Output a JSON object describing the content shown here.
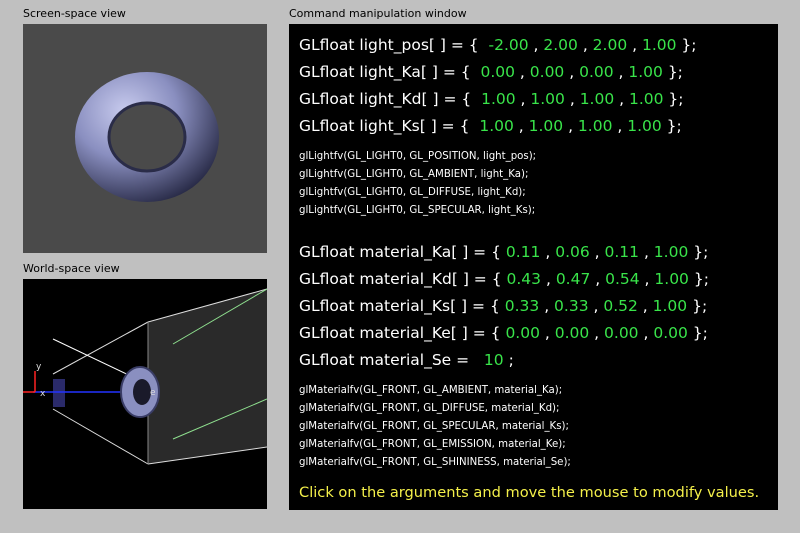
{
  "labels": {
    "screen_view": "Screen-space view",
    "world_view": "World-space view",
    "command_window": "Command manipulation window"
  },
  "colors": {
    "background": "#c0c0c0",
    "value": "#39e44a",
    "hint": "#f4f04a",
    "torus": "#8a8fc0"
  },
  "world_view": {
    "axis_x": "x",
    "axis_y": "y",
    "eye": "e"
  },
  "light": {
    "pos": {
      "decl": "GLfloat light_pos[ ] = {",
      "v": [
        "-2.00",
        "2.00",
        "2.00",
        "1.00"
      ]
    },
    "ka": {
      "decl": "GLfloat light_Ka[ ] = {",
      "v": [
        "0.00",
        "0.00",
        "0.00",
        "1.00"
      ]
    },
    "kd": {
      "decl": "GLfloat light_Kd[ ] = {",
      "v": [
        "1.00",
        "1.00",
        "1.00",
        "1.00"
      ]
    },
    "ks": {
      "decl": "GLfloat light_Ks[ ] = {",
      "v": [
        "1.00",
        "1.00",
        "1.00",
        "1.00"
      ]
    }
  },
  "light_calls": [
    "glLightfv(GL_LIGHT0, GL_POSITION, light_pos);",
    "glLightfv(GL_LIGHT0, GL_AMBIENT, light_Ka);",
    "glLightfv(GL_LIGHT0, GL_DIFFUSE, light_Kd);",
    "glLightfv(GL_LIGHT0, GL_SPECULAR, light_Ks);"
  ],
  "material": {
    "ka": {
      "decl": "GLfloat material_Ka[ ] = {",
      "v": [
        "0.11",
        "0.06",
        "0.11",
        "1.00"
      ]
    },
    "kd": {
      "decl": "GLfloat material_Kd[ ] = {",
      "v": [
        "0.43",
        "0.47",
        "0.54",
        "1.00"
      ]
    },
    "ks": {
      "decl": "GLfloat material_Ks[ ] = {",
      "v": [
        "0.33",
        "0.33",
        "0.52",
        "1.00"
      ]
    },
    "ke": {
      "decl": "GLfloat material_Ke[ ] = {",
      "v": [
        "0.00",
        "0.00",
        "0.00",
        "0.00"
      ]
    },
    "se": {
      "decl": "GLfloat material_Se =",
      "v": "10"
    }
  },
  "material_calls": [
    "glMaterialfv(GL_FRONT, GL_AMBIENT, material_Ka);",
    "glMaterialfv(GL_FRONT, GL_DIFFUSE, material_Kd);",
    "glMaterialfv(GL_FRONT, GL_SPECULAR, material_Ks);",
    "glMaterialfv(GL_FRONT, GL_EMISSION, material_Ke);",
    "glMaterialfv(GL_FRONT, GL_SHININESS, material_Se);"
  ],
  "punct": {
    "comma": " , ",
    "close": " };",
    "semi": " ;"
  },
  "hint": "Click on the arguments and move the mouse to modify values."
}
